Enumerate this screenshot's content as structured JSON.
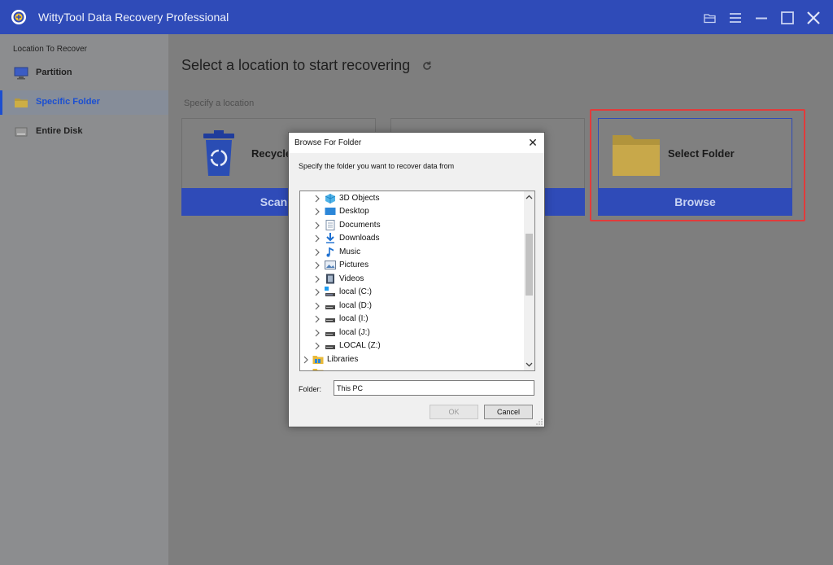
{
  "app": {
    "title": "WittyTool Data Recovery Professional",
    "accent_color": "#2f4bb8",
    "titlebar_icons": [
      "folder-open-icon",
      "menu-icon",
      "minimize-icon",
      "maximize-icon",
      "close-icon"
    ]
  },
  "sidebar": {
    "header": "Location To Recover",
    "items": [
      {
        "label": "Partition",
        "icon": "monitor-icon",
        "active": false
      },
      {
        "label": "Specific Folder",
        "icon": "folder-icon",
        "active": true
      },
      {
        "label": "Entire Disk",
        "icon": "disk-icon",
        "active": false
      }
    ]
  },
  "main": {
    "title": "Select a location to start recovering",
    "subtitle": "Specify a location",
    "cards": [
      {
        "label": "Recycle",
        "button": "Scan",
        "icon": "recycle-bin-icon"
      },
      {
        "label": "",
        "button": "",
        "icon": ""
      },
      {
        "label": "Select Folder",
        "button": "Browse",
        "icon": "folder-icon"
      }
    ]
  },
  "dialog": {
    "title": "Browse For Folder",
    "instruction": "Specify the folder you want to recover data from",
    "tree": [
      {
        "label": "3D Objects",
        "icon": "3d-objects-icon",
        "level": 1
      },
      {
        "label": "Desktop",
        "icon": "desktop-icon",
        "level": 1
      },
      {
        "label": "Documents",
        "icon": "documents-icon",
        "level": 1
      },
      {
        "label": "Downloads",
        "icon": "downloads-icon",
        "level": 1
      },
      {
        "label": "Music",
        "icon": "music-icon",
        "level": 1
      },
      {
        "label": "Pictures",
        "icon": "pictures-icon",
        "level": 1
      },
      {
        "label": "Videos",
        "icon": "videos-icon",
        "level": 1
      },
      {
        "label": "local (C:)",
        "icon": "system-drive-icon",
        "level": 1
      },
      {
        "label": "local (D:)",
        "icon": "drive-icon",
        "level": 1
      },
      {
        "label": "local (I:)",
        "icon": "drive-icon",
        "level": 1
      },
      {
        "label": "local (J:)",
        "icon": "drive-icon",
        "level": 1
      },
      {
        "label": "LOCAL (Z:)",
        "icon": "drive-icon",
        "level": 1
      },
      {
        "label": "Libraries",
        "icon": "libraries-icon",
        "level": 0
      }
    ],
    "folder_label": "Folder:",
    "folder_value": "This PC",
    "ok_label": "OK",
    "cancel_label": "Cancel"
  }
}
